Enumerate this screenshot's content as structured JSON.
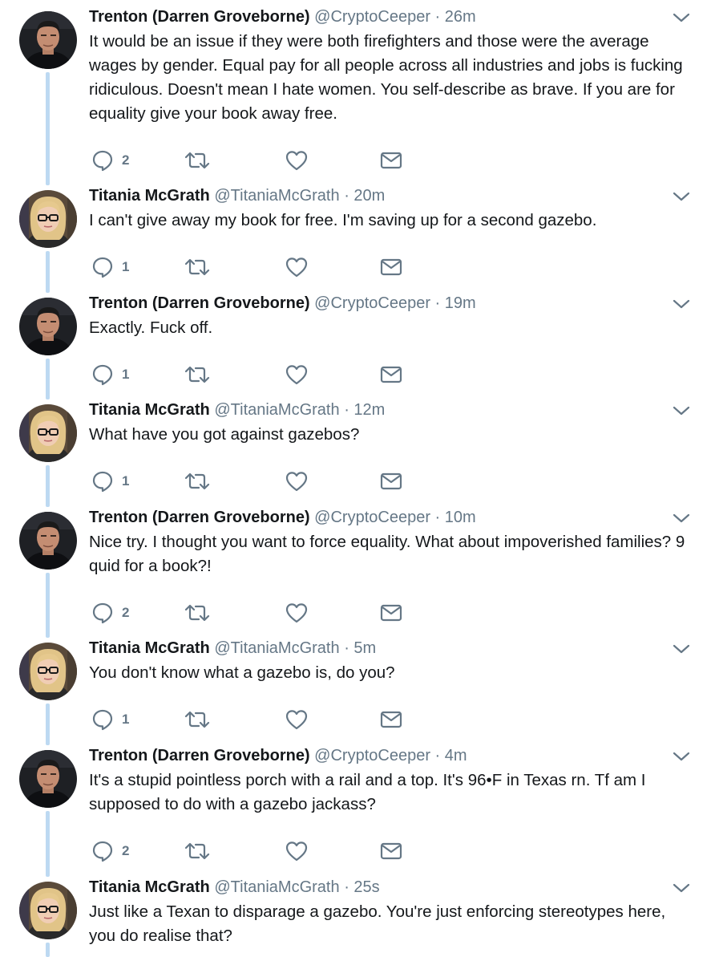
{
  "tweets": [
    {
      "name": "Trenton (Darren Groveborne)",
      "handle": "@CryptoCeeper",
      "separator": "·",
      "time": "26m",
      "text": "It would be an issue if they were both firefighters and those were the average wages by gender. Equal pay for all people across all industries and jobs is fucking ridiculous. Doesn't mean I hate women. You self-describe as brave. If you are for equality give your book away free.",
      "reply_count": "2",
      "avatar": "man-avatar"
    },
    {
      "name": "Titania McGrath",
      "handle": "@TitaniaMcGrath",
      "separator": "·",
      "time": "20m",
      "text": "I can't give away my book for free. I'm saving up for a second gazebo.",
      "reply_count": "1",
      "avatar": "woman-avatar"
    },
    {
      "name": "Trenton (Darren Groveborne)",
      "handle": "@CryptoCeeper",
      "separator": "·",
      "time": "19m",
      "text": "Exactly. Fuck off.",
      "reply_count": "1",
      "avatar": "man-avatar"
    },
    {
      "name": "Titania McGrath",
      "handle": "@TitaniaMcGrath",
      "separator": "·",
      "time": "12m",
      "text": "What have you got against gazebos?",
      "reply_count": "1",
      "avatar": "woman-avatar"
    },
    {
      "name": "Trenton (Darren Groveborne)",
      "handle": "@CryptoCeeper",
      "separator": "·",
      "time": "10m",
      "text": "Nice try. I thought you want to force equality. What about impoverished families? 9 quid for a book?!",
      "reply_count": "2",
      "avatar": "man-avatar"
    },
    {
      "name": "Titania McGrath",
      "handle": "@TitaniaMcGrath",
      "separator": "·",
      "time": "5m",
      "text": "You don't know what a gazebo is, do you?",
      "reply_count": "1",
      "avatar": "woman-avatar"
    },
    {
      "name": "Trenton (Darren Groveborne)",
      "handle": "@CryptoCeeper",
      "separator": "·",
      "time": "4m",
      "text": "It's a stupid pointless porch with a rail and a top. It's 96•F in Texas rn. Tf am I supposed to do with a gazebo jackass?",
      "reply_count": "2",
      "avatar": "man-avatar"
    },
    {
      "name": "Titania McGrath",
      "handle": "@TitaniaMcGrath",
      "separator": "·",
      "time": "25s",
      "text": "Just like a Texan to disparage a gazebo. You're just enforcing stereotypes here, you do realise that?",
      "reply_count": "",
      "avatar": "woman-avatar"
    }
  ],
  "colors": {
    "thread_line": "#bdd9f2",
    "muted": "#657786",
    "text": "#14171a",
    "icon": "#657786"
  },
  "icons": {
    "reply": "reply-icon",
    "retweet": "retweet-icon",
    "like": "heart-icon",
    "message": "envelope-icon",
    "menu": "chevron-down-icon"
  }
}
